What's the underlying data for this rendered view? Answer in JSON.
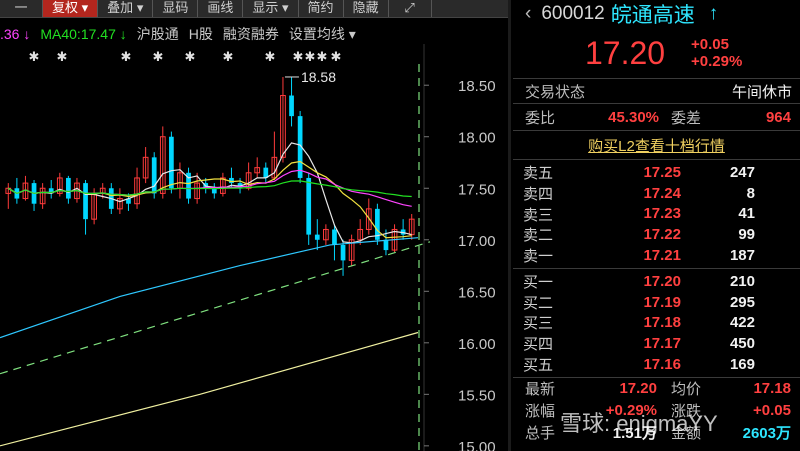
{
  "toolbar": {
    "items": [
      "一",
      "复权",
      "叠加",
      "显码",
      "画线",
      "显示",
      "简约",
      "隐藏"
    ]
  },
  "indicators": {
    "ma_prev": ".36",
    "ma40": "MA40:17.47",
    "links": [
      "沪股通",
      "H股",
      "融资融券",
      "设置均线"
    ]
  },
  "stock": {
    "code": "600012",
    "name": "皖通高速",
    "price": "17.20",
    "change": "+0.05",
    "change_pct": "+0.29%"
  },
  "status": {
    "label": "交易状态",
    "value": "午间休市"
  },
  "ratio": {
    "wei_bi_label": "委比",
    "wei_bi": "45.30%",
    "wei_cha_label": "委差",
    "wei_cha": "964"
  },
  "l2_link": "购买L2查看十档行情",
  "asks": [
    {
      "name": "卖五",
      "price": "17.25",
      "vol": "247"
    },
    {
      "name": "卖四",
      "price": "17.24",
      "vol": "8"
    },
    {
      "name": "卖三",
      "price": "17.23",
      "vol": "41"
    },
    {
      "name": "卖二",
      "price": "17.22",
      "vol": "99"
    },
    {
      "name": "卖一",
      "price": "17.21",
      "vol": "187"
    }
  ],
  "bids": [
    {
      "name": "买一",
      "price": "17.20",
      "vol": "210"
    },
    {
      "name": "买二",
      "price": "17.19",
      "vol": "295"
    },
    {
      "name": "买三",
      "price": "17.18",
      "vol": "422"
    },
    {
      "name": "买四",
      "price": "17.17",
      "vol": "450"
    },
    {
      "name": "买五",
      "price": "17.16",
      "vol": "169"
    }
  ],
  "stats": {
    "latest_label": "最新",
    "latest": "17.20",
    "avg_label": "均价",
    "avg": "17.18",
    "chg_pct_label": "涨幅",
    "chg_pct": "+0.29%",
    "chg_label": "涨跌",
    "chg": "+0.05",
    "hands_label": "总手",
    "hands": "1.51万",
    "amount_label": "金额",
    "amount": "2603万"
  },
  "watermark": "雪球: enigmaYY",
  "colors": {
    "up": "#ff3b3b",
    "down": "#00d7ff",
    "toolbar_active": "#b3261e"
  },
  "chart_data": {
    "type": "candlestick",
    "yaxis_ticks": [
      "18.50",
      "18.00",
      "17.50",
      "17.00",
      "16.50",
      "16.00",
      "15.50",
      "15.00"
    ],
    "ylim": [
      14.95,
      18.9
    ],
    "annotation": "18.58",
    "candles": [
      [
        17.45,
        17.5,
        17.55,
        17.3
      ],
      [
        17.5,
        17.4,
        17.6,
        17.35
      ],
      [
        17.4,
        17.55,
        17.62,
        17.38
      ],
      [
        17.55,
        17.35,
        17.58,
        17.28
      ],
      [
        17.35,
        17.5,
        17.55,
        17.3
      ],
      [
        17.5,
        17.45,
        17.58,
        17.4
      ],
      [
        17.45,
        17.6,
        17.65,
        17.42
      ],
      [
        17.6,
        17.4,
        17.62,
        17.35
      ],
      [
        17.4,
        17.55,
        17.6,
        17.36
      ],
      [
        17.55,
        17.2,
        17.58,
        17.05
      ],
      [
        17.2,
        17.45,
        17.5,
        17.15
      ],
      [
        17.45,
        17.5,
        17.55,
        17.4
      ],
      [
        17.5,
        17.3,
        17.55,
        17.25
      ],
      [
        17.3,
        17.4,
        17.5,
        17.25
      ],
      [
        17.4,
        17.35,
        17.45,
        17.28
      ],
      [
        17.35,
        17.6,
        17.7,
        17.3
      ],
      [
        17.6,
        17.8,
        17.9,
        17.55
      ],
      [
        17.8,
        17.45,
        17.85,
        17.4
      ],
      [
        17.45,
        18.0,
        18.1,
        17.4
      ],
      [
        18.0,
        17.5,
        18.05,
        17.45
      ],
      [
        17.5,
        17.65,
        17.75,
        17.4
      ],
      [
        17.65,
        17.4,
        17.7,
        17.35
      ],
      [
        17.4,
        17.55,
        17.65,
        17.35
      ],
      [
        17.55,
        17.5,
        17.6,
        17.45
      ],
      [
        17.5,
        17.45,
        17.55,
        17.4
      ],
      [
        17.45,
        17.6,
        17.65,
        17.42
      ],
      [
        17.6,
        17.55,
        17.7,
        17.5
      ],
      [
        17.55,
        17.5,
        17.6,
        17.45
      ],
      [
        17.5,
        17.65,
        17.75,
        17.48
      ],
      [
        17.65,
        17.7,
        17.8,
        17.6
      ],
      [
        17.7,
        17.6,
        17.75,
        17.55
      ],
      [
        17.6,
        17.8,
        18.05,
        17.58
      ],
      [
        17.8,
        18.4,
        18.58,
        17.75
      ],
      [
        18.4,
        18.2,
        18.58,
        18.1
      ],
      [
        18.2,
        17.6,
        18.25,
        17.55
      ],
      [
        17.6,
        17.05,
        17.65,
        16.95
      ],
      [
        17.05,
        17.0,
        17.2,
        16.9
      ],
      [
        17.0,
        17.1,
        17.15,
        16.95
      ],
      [
        17.1,
        16.95,
        17.15,
        16.8
      ],
      [
        16.95,
        16.8,
        17.0,
        16.65
      ],
      [
        16.8,
        17.0,
        17.05,
        16.75
      ],
      [
        17.0,
        17.1,
        17.2,
        16.95
      ],
      [
        17.1,
        17.3,
        17.4,
        17.05
      ],
      [
        17.3,
        17.0,
        17.35,
        16.95
      ],
      [
        17.0,
        16.9,
        17.1,
        16.85
      ],
      [
        16.9,
        17.1,
        17.15,
        16.88
      ],
      [
        17.1,
        17.05,
        17.2,
        17.0
      ],
      [
        17.05,
        17.2,
        17.25,
        17.0
      ]
    ]
  }
}
